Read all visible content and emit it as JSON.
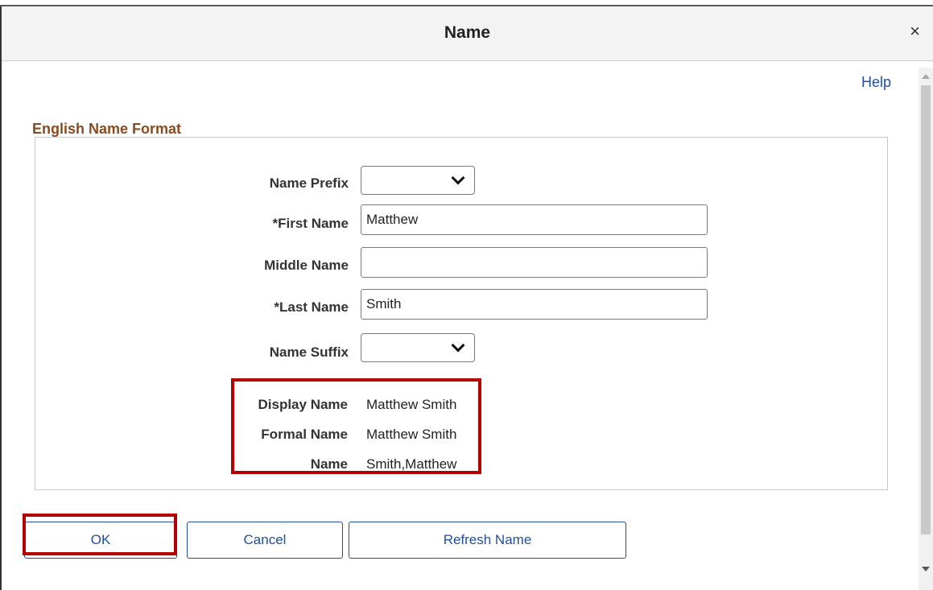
{
  "dialog": {
    "title": "Name",
    "close_symbol": "×",
    "help_label": "Help"
  },
  "section": {
    "title": "English Name Format"
  },
  "form": {
    "name_prefix": {
      "label": "Name Prefix",
      "value": ""
    },
    "first_name": {
      "label": "*First Name",
      "value": "Matthew"
    },
    "middle_name": {
      "label": "Middle Name",
      "value": ""
    },
    "last_name": {
      "label": "*Last Name",
      "value": "Smith"
    },
    "name_suffix": {
      "label": "Name Suffix",
      "value": ""
    }
  },
  "display": {
    "display_name": {
      "label": "Display Name",
      "value": "Matthew Smith"
    },
    "formal_name": {
      "label": "Formal Name",
      "value": "Matthew Smith"
    },
    "name": {
      "label": "Name",
      "value": "Smith,Matthew"
    }
  },
  "buttons": {
    "ok": "OK",
    "cancel": "Cancel",
    "refresh": "Refresh Name"
  },
  "colors": {
    "link": "#1f4e9a",
    "section_title": "#8a4a1f",
    "highlight": "#b30000"
  }
}
